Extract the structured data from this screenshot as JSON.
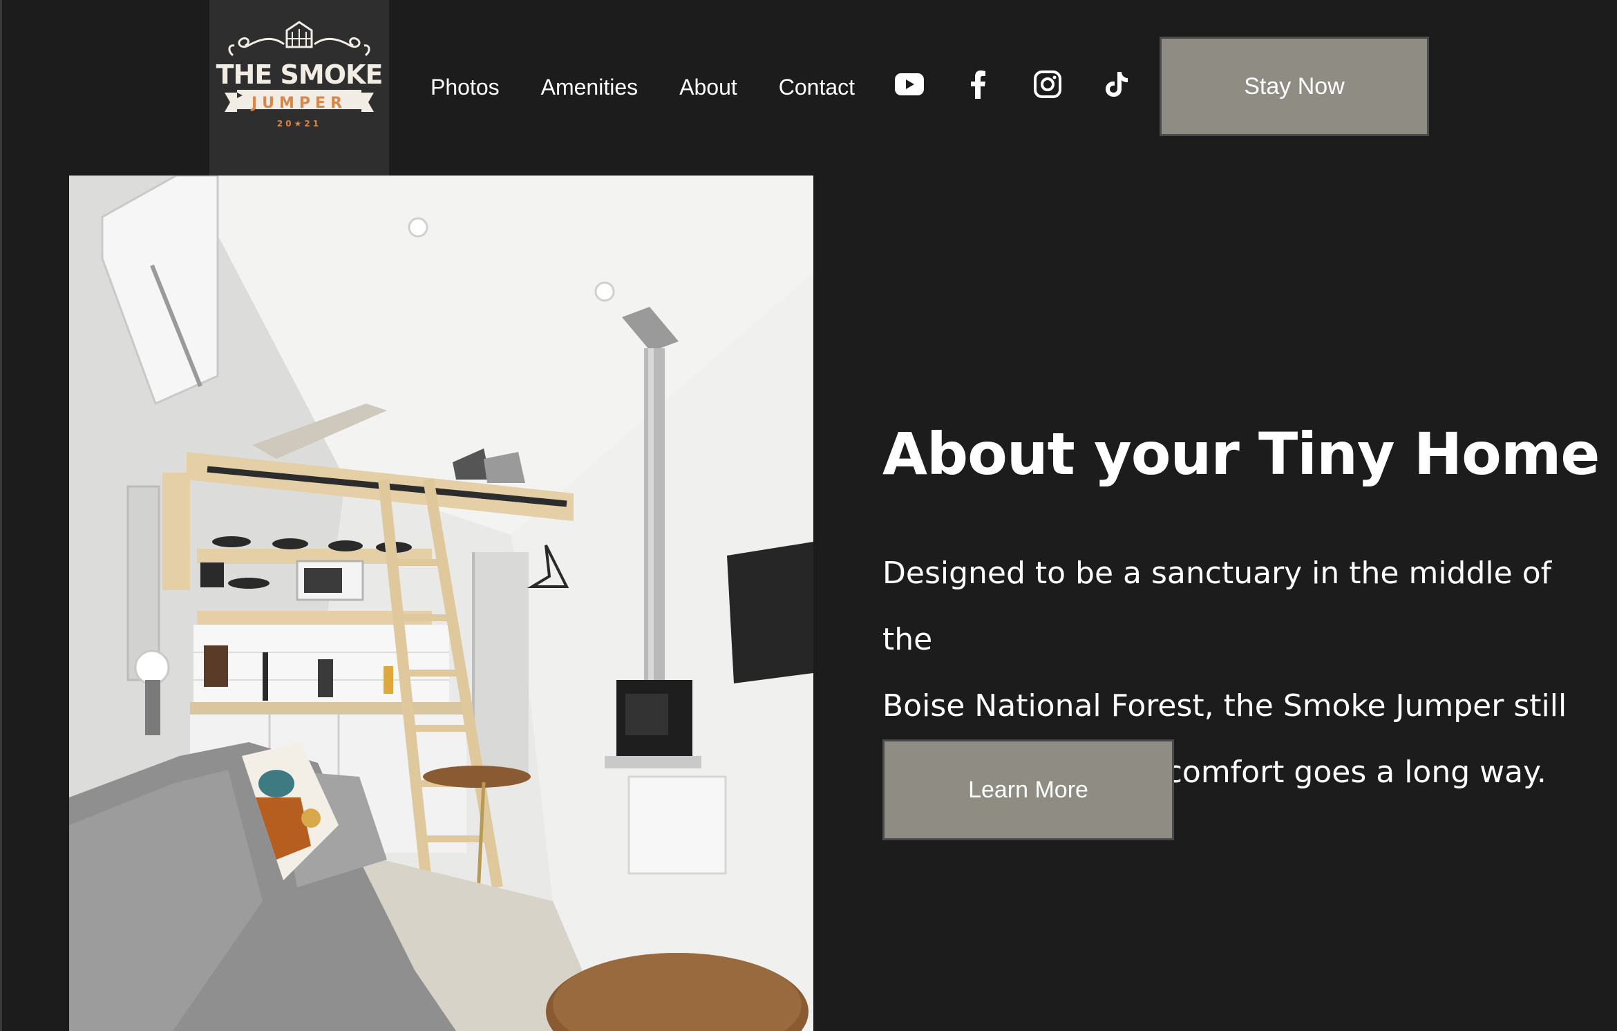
{
  "header": {
    "logo": {
      "title": "THE SMOKE",
      "subtitle": "JUMPER",
      "year": "20★21"
    },
    "nav": [
      {
        "label": "Photos"
      },
      {
        "label": "Amenities"
      },
      {
        "label": "About"
      },
      {
        "label": "Contact"
      }
    ],
    "social_icons": [
      "youtube-icon",
      "facebook-icon",
      "instagram-icon",
      "tiktok-icon"
    ],
    "cta_label": "Stay Now"
  },
  "about": {
    "title": "About your Tiny Home",
    "body_lines": [
      "Designed to be a sanctuary in the middle of the",
      "Boise National Forest, the Smoke Jumper still",
      "knows that a little comfort goes a long way."
    ],
    "button_label": "Learn More"
  },
  "colors": {
    "background": "#1c1c1c",
    "logo_panel": "#2e2e2e",
    "button": "#8f8c84",
    "accent_orange": "#d9864a"
  }
}
